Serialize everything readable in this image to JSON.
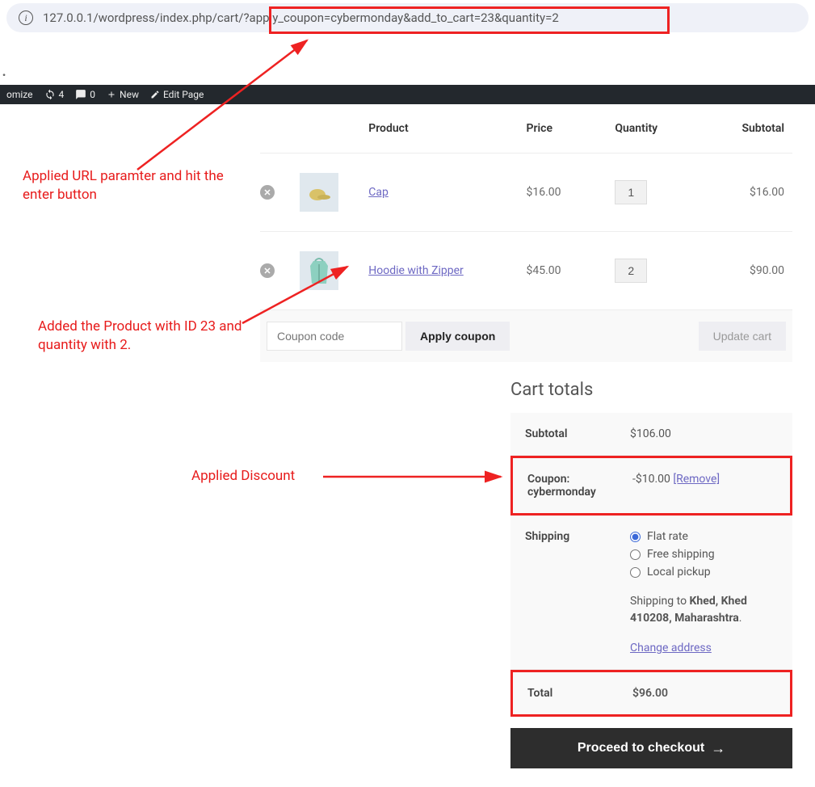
{
  "url": "127.0.0.1/wordpress/index.php/cart/?apply_coupon=cybermonday&add_to_cart=23&quantity=2",
  "adminbar": {
    "customize": "omize",
    "refresh_count": "4",
    "comments_count": "0",
    "new": "New",
    "edit": "Edit Page"
  },
  "headers": {
    "product": "Product",
    "price": "Price",
    "quantity": "Quantity",
    "subtotal": "Subtotal"
  },
  "rows": [
    {
      "name": "Cap",
      "price": "$16.00",
      "qty": "1",
      "subtotal": "$16.00",
      "thumb": "cap"
    },
    {
      "name": "Hoodie with Zipper",
      "price": "$45.00",
      "qty": "2",
      "subtotal": "$90.00",
      "thumb": "hoodie"
    }
  ],
  "coupon_placeholder": "Coupon code",
  "apply_coupon_label": "Apply coupon",
  "update_cart_label": "Update cart",
  "totals": {
    "title": "Cart totals",
    "subtotal_label": "Subtotal",
    "subtotal_value": "$106.00",
    "coupon_label": "Coupon: cybermonday",
    "coupon_value": "-$10.00 ",
    "coupon_remove": "[Remove]",
    "shipping_label": "Shipping",
    "ship_options": [
      "Flat rate",
      "Free shipping",
      "Local pickup"
    ],
    "ship_to_prefix": "Shipping to ",
    "ship_to_bold": "Khed, Khed 410208, Maharashtra",
    "change_address": "Change address",
    "total_label": "Total",
    "total_value": "$96.00",
    "checkout": "Proceed to checkout"
  },
  "annotations": {
    "a1": "Applied URL paramter and hit the enter button",
    "a2": "Added the Product with ID 23 and quantity with 2.",
    "a3": "Applied Discount"
  }
}
